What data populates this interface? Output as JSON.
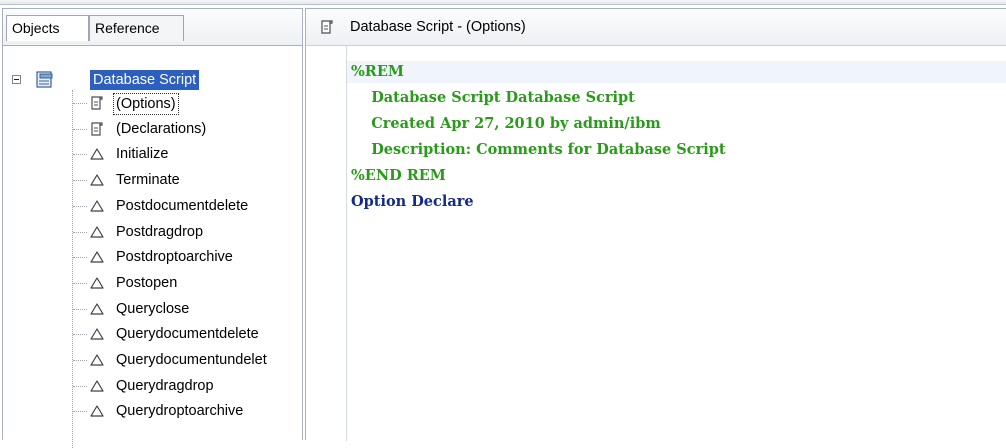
{
  "left_panel": {
    "tabs": [
      "Objects",
      "Reference"
    ],
    "tree": {
      "root": "Database Script",
      "items": [
        {
          "label": "(Options)",
          "icon": "script-icon"
        },
        {
          "label": "(Declarations)",
          "icon": "script-icon"
        },
        {
          "label": "Initialize",
          "icon": "triangle-icon"
        },
        {
          "label": "Terminate",
          "icon": "triangle-icon"
        },
        {
          "label": "Postdocumentdelete",
          "icon": "triangle-icon"
        },
        {
          "label": "Postdragdrop",
          "icon": "triangle-icon"
        },
        {
          "label": "Postdroptoarchive",
          "icon": "triangle-icon"
        },
        {
          "label": "Postopen",
          "icon": "triangle-icon"
        },
        {
          "label": "Queryclose",
          "icon": "triangle-icon"
        },
        {
          "label": "Querydocumentdelete",
          "icon": "triangle-icon"
        },
        {
          "label": "Querydocumentundelet",
          "icon": "triangle-icon"
        },
        {
          "label": "Querydragdrop",
          "icon": "triangle-icon"
        },
        {
          "label": "Querydroptoarchive",
          "icon": "triangle-icon"
        }
      ]
    }
  },
  "editor": {
    "title": "Database Script - (Options)",
    "lines": [
      {
        "text": "%REM",
        "color": "#2a9a1a"
      },
      {
        "text": "    Database Script Database Script",
        "color": "#2a9a1a"
      },
      {
        "text": "    Created Apr 27, 2010 by admin/ibm",
        "color": "#2a9a1a"
      },
      {
        "text": "    Description: Comments for Database Script",
        "color": "#2a9a1a"
      },
      {
        "text": "%END REM",
        "color": "#2a9a1a"
      },
      {
        "text": "Option Declare",
        "color": "#132a88"
      }
    ]
  }
}
